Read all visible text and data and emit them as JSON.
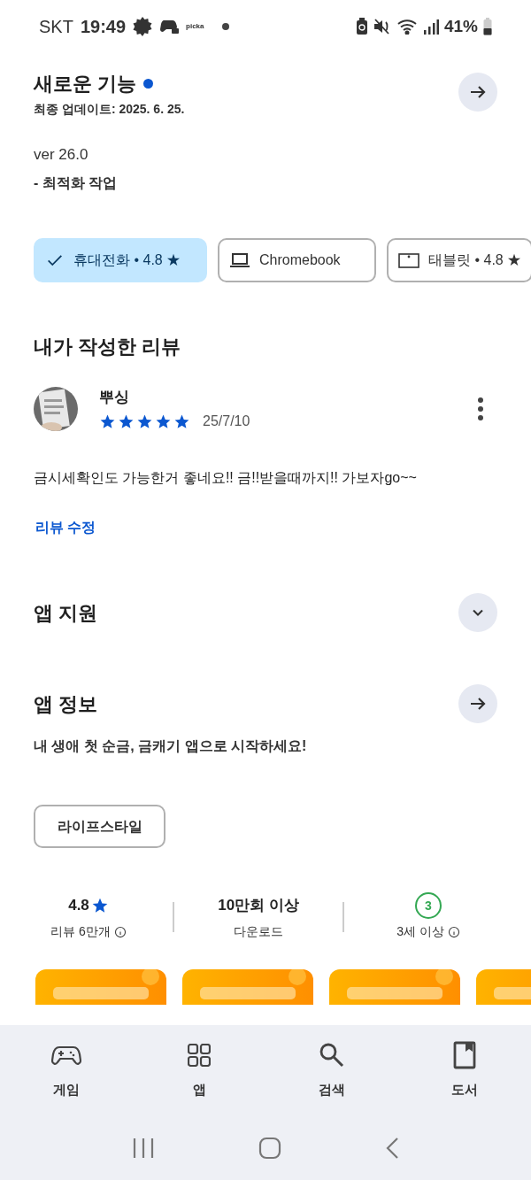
{
  "status_bar": {
    "carrier": "SKT",
    "time": "19:49",
    "app_label": "picka",
    "battery": "41%"
  },
  "whats_new": {
    "title": "새로운 기능",
    "new": true,
    "updated": "최종 업데이트: 2025. 6. 25.",
    "version": "ver 26.0",
    "notes": "- 최적화 작업"
  },
  "devices": [
    {
      "kind": "phone",
      "label": "휴대전화 • 4.8 ★",
      "selected": true
    },
    {
      "kind": "laptop",
      "label": "Chromebook",
      "selected": false
    },
    {
      "kind": "tablet",
      "label": "태블릿 • 4.8 ★",
      "selected": false
    }
  ],
  "my_review": {
    "title": "내가 작성한 리뷰",
    "author": "뿌싱",
    "stars": 5,
    "date": "25/7/10",
    "text": "금시세확인도 가능한거 좋네요!! 금!!받을때까지!! 가보자go~~",
    "edit_link": "리뷰 수정"
  },
  "app_support": {
    "title": "앱 지원",
    "expanded": false
  },
  "app_info": {
    "title": "앱 정보",
    "description": "내 생애 첫 순금, 금캐기 앱으로 시작하세요!",
    "category": "라이프스타일"
  },
  "stats": [
    {
      "kind": "rating",
      "value": "4.8",
      "label": "리뷰 6만개"
    },
    {
      "kind": "downloads",
      "value": "10만회 이상",
      "label": "다운로드"
    },
    {
      "kind": "age",
      "value": "3",
      "label": "3세 이상"
    }
  ],
  "bottom_nav": [
    {
      "kind": "games",
      "label": "게임",
      "selected": false
    },
    {
      "kind": "apps",
      "label": "앱",
      "selected": false
    },
    {
      "kind": "search",
      "label": "검색",
      "selected": false
    },
    {
      "kind": "books",
      "label": "도서",
      "selected": false
    }
  ]
}
